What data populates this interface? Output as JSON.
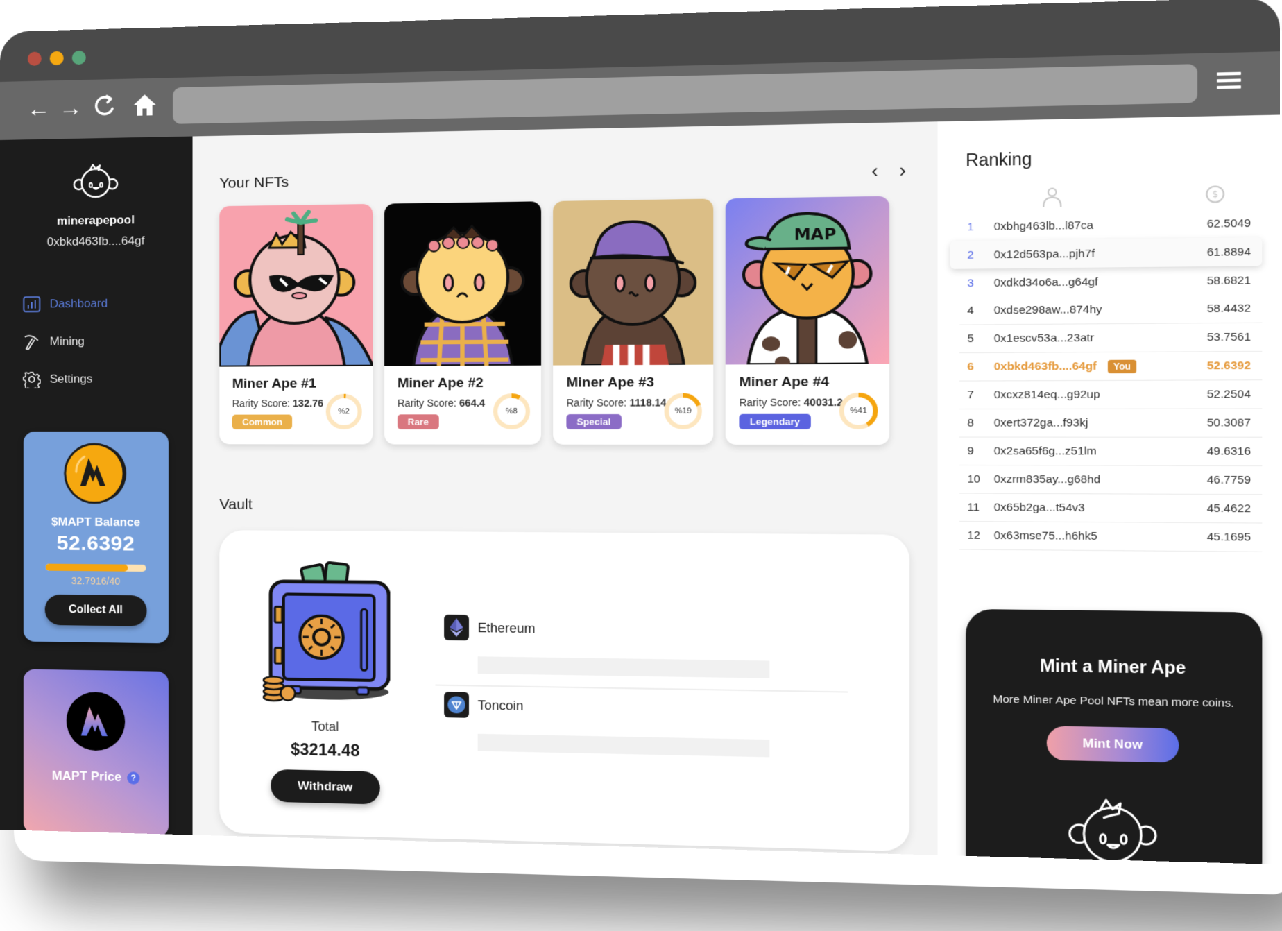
{
  "browser": {
    "window_controls": [
      "close",
      "minimize",
      "maximize"
    ],
    "nav_icons": [
      "back-arrow-icon",
      "forward-arrow-icon",
      "reload-icon",
      "home-icon"
    ],
    "url": "",
    "menu_icon": "hamburger-menu-icon"
  },
  "sidebar": {
    "profile": {
      "name": "minerapepool",
      "address": "0xbkd463fb....64gf"
    },
    "nav": [
      {
        "label": "Dashboard",
        "icon": "bar-chart-icon",
        "active": true
      },
      {
        "label": "Mining",
        "icon": "pickaxe-icon",
        "active": false
      },
      {
        "label": "Settings",
        "icon": "gear-icon",
        "active": false
      }
    ],
    "balance_card": {
      "label": "$MAPT Balance",
      "value": "52.6392",
      "progress_text": "32.7916/40",
      "progress_current": 32.7916,
      "progress_max": 40,
      "button_label": "Collect All"
    },
    "price_card": {
      "label": "MAPT Price",
      "help": "?"
    }
  },
  "main": {
    "nfts_title": "Your NFTs",
    "carousel_prev": "‹",
    "carousel_next": "›",
    "nfts": [
      {
        "name": "Miner Ape #1",
        "score_label": "Rarity Score:",
        "score": "132.76",
        "rarity": "Common",
        "rarity_color": "#eab04a",
        "percent": 2,
        "percent_label": "%2",
        "bg": "#f8a2ad"
      },
      {
        "name": "Miner Ape #2",
        "score_label": "Rarity Score:",
        "score": "664.4",
        "rarity": "Rare",
        "rarity_color": "#d9777f",
        "percent": 8,
        "percent_label": "%8",
        "bg": "#050505"
      },
      {
        "name": "Miner Ape #3",
        "score_label": "Rarity Score:",
        "score": "1118.14",
        "rarity": "Special",
        "rarity_color": "#8b6cc6",
        "percent": 19,
        "percent_label": "%19",
        "bg": "#dbbe86"
      },
      {
        "name": "Miner Ape #4",
        "score_label": "Rarity Score:",
        "score": "40031.2",
        "rarity": "Legendary",
        "rarity_color": "#5b63e0",
        "percent": 41,
        "percent_label": "%41",
        "bg": "#8a86ee"
      }
    ],
    "vault": {
      "title": "Vault",
      "total_label": "Total",
      "total_value": "$3214.48",
      "withdraw_label": "Withdraw",
      "assets": [
        {
          "name": "Ethereum",
          "icon": "ethereum-icon"
        },
        {
          "name": "Toncoin",
          "icon": "toncoin-icon"
        }
      ]
    }
  },
  "ranking": {
    "title": "Ranking",
    "columns": [
      "user-icon",
      "dollar-coin-icon"
    ],
    "rows": [
      {
        "rank": "1",
        "address": "0xbhg463lb...l87ca",
        "value": "62.5049"
      },
      {
        "rank": "2",
        "address": "0x12d563pa...pjh7f",
        "value": "61.8894"
      },
      {
        "rank": "3",
        "address": "0xdkd34o6a...g64gf",
        "value": "58.6821"
      },
      {
        "rank": "4",
        "address": "0xdse298aw...874hy",
        "value": "58.4432"
      },
      {
        "rank": "5",
        "address": "0x1escv53a...23atr",
        "value": "53.7561"
      },
      {
        "rank": "6",
        "address": "0xbkd463fb....64gf",
        "value": "52.6392",
        "you": "You"
      },
      {
        "rank": "7",
        "address": "0xcxz814eq...g92up",
        "value": "52.2504"
      },
      {
        "rank": "8",
        "address": "0xert372ga...f93kj",
        "value": "50.3087"
      },
      {
        "rank": "9",
        "address": "0x2sa65f6g...z51lm",
        "value": "49.6316"
      },
      {
        "rank": "10",
        "address": "0xzrm835ay...g68hd",
        "value": "46.7759"
      },
      {
        "rank": "11",
        "address": "0x65b2ga...t54v3",
        "value": "45.4622"
      },
      {
        "rank": "12",
        "address": "0x63mse75...h6hk5",
        "value": "45.1695"
      }
    ]
  },
  "mint": {
    "title": "Mint a Miner Ape",
    "subtitle": "More Miner Ape Pool NFTs mean more coins.",
    "button_label": "Mint Now"
  },
  "colors": {
    "accent_blue": "#5b6ee8",
    "accent_orange": "#f5a50f",
    "sidebar_bg": "#1c1c1c",
    "balance_card_bg": "#77a0db",
    "you_color": "#e5993a"
  }
}
